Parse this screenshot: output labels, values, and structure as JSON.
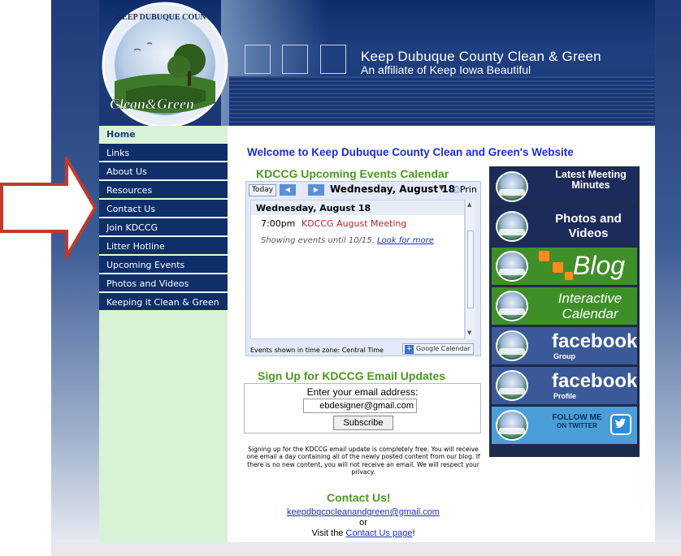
{
  "header": {
    "logo_top_text": "KEEP DUBUQUE COUNTY",
    "logo_script_text": "Clean&Green",
    "title": "Keep Dubuque County Clean & Green",
    "subtitle": "An affiliate of Keep Iowa Beautiful"
  },
  "sidebar": {
    "items": [
      {
        "label": "Home",
        "active": true
      },
      {
        "label": "Links"
      },
      {
        "label": "About Us"
      },
      {
        "label": "Resources"
      },
      {
        "label": "Contact Us"
      },
      {
        "label": "Join KDCCG"
      },
      {
        "label": "Litter Hotline"
      },
      {
        "label": "Upcoming Events"
      },
      {
        "label": "Photos and Videos"
      },
      {
        "label": "Keeping it Clean & Green"
      }
    ]
  },
  "main": {
    "welcome": "Welcome to Keep Dubuque County Clean and Green's Website",
    "calendar": {
      "heading": "KDCCG Upcoming Events Calendar",
      "today_label": "Today",
      "prev_icon": "◀",
      "next_icon": "▶",
      "date": "Wednesday, August 18",
      "print_label": "Prin",
      "day_header": "Wednesday, August 18",
      "event_time": "7:00pm",
      "event_title": "KDCCG August Meeting",
      "showing_text": "Showing events until 10/15.",
      "look_more": "Look for more",
      "timezone_text": "Events shown in time zone: Central Time",
      "gcal_label": "Google Calendar"
    },
    "signup": {
      "heading": "Sign Up for KDCCG Email Updates",
      "prompt": "Enter your email address:",
      "email_value": "ebdesigner@gmail.com",
      "subscribe_label": "Subscribe",
      "note": "Signing up for the KDCCG email update is completely free. You will receive one email a day containing all of the newly posted content from our blog. If there is no new content, you will not receive an email. We will respect your privacy."
    },
    "contact": {
      "heading": "Contact Us!",
      "email": "keepdbqcocleanandgreen@gmail.com",
      "or_text": "or",
      "visit_prefix": "Visit the ",
      "visit_link": "Contact Us page",
      "visit_suffix": "!"
    }
  },
  "promos": [
    {
      "label": "Latest Meeting Minutes",
      "bg": "#1d2b5a"
    },
    {
      "label": "Photos and Videos",
      "bg": "#1d2b5a"
    },
    {
      "label": "Blog",
      "bg": "#3f8f28"
    },
    {
      "label": "Interactive Calendar",
      "bg": "#3f8f28"
    },
    {
      "label": "facebook",
      "sub": "Group",
      "bg": "#3b5998"
    },
    {
      "label": "facebook",
      "sub": "Profile",
      "bg": "#3b5998"
    },
    {
      "label": "FOLLOW ME",
      "sub": "ON TWITTER",
      "bg": "#4a9fd8"
    }
  ],
  "colors": {
    "nav_bg": "#0f2f6b",
    "sidebar_bg": "#d9f2d6",
    "accent_green": "#4a9a1e",
    "link_blue": "#1a2fd0",
    "arrow_red": "#c0392b"
  }
}
